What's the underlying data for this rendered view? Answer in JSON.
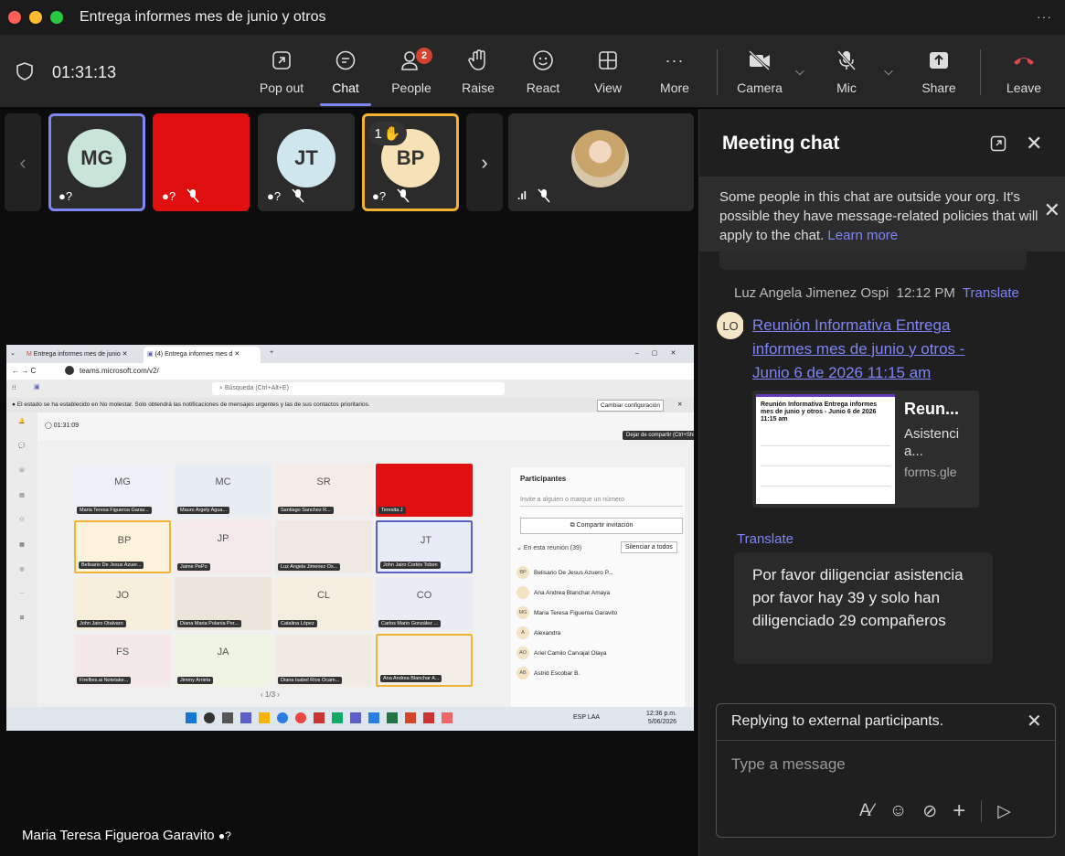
{
  "window": {
    "title": "Entrega informes mes de junio y otros",
    "more": "···"
  },
  "toolbar": {
    "timer": "01:31:13",
    "popout": "Pop out",
    "chat": "Chat",
    "people": "People",
    "people_badge": "2",
    "raise": "Raise",
    "react": "React",
    "view": "View",
    "more": "More",
    "camera": "Camera",
    "mic": "Mic",
    "share": "Share",
    "leave": "Leave"
  },
  "gallery": {
    "tiles": [
      {
        "initials": "MG",
        "color": "#c9e4d8"
      },
      {
        "initials": "",
        "color": "#e01010"
      },
      {
        "initials": "JT",
        "color": "#cfe6ec"
      },
      {
        "initials": "BP",
        "color": "#f7e2b7",
        "hand": "1"
      }
    ]
  },
  "shared": {
    "tab1": "Entrega informes mes de junio",
    "tab2": "(4) Entrega informes mes d",
    "url": "teams.microsoft.com/v2/",
    "search": "Búsqueda (Ctrl+Alt+E)",
    "dnd": "El estado se ha establecido en No molestar. Solo obtendrá las notificaciones de mensajes urgentes y las de sus contactos prioritarios.",
    "dnd_button": "Cambiar configuración",
    "timer": "01:31:09",
    "tooltip": "Dejar de compartir (Ctrl+Shift+E)",
    "participants_title": "Participantes",
    "invite_placeholder": "Invite a alguien o marque un número",
    "share_invite": "Compartir invitación",
    "in_meeting": "En esta reunión (39)",
    "mute_all": "Silenciar a todos",
    "pager": "1/3",
    "clock": "12:36 p.m.",
    "date": "5/06/2026",
    "lang": "ESP LAA",
    "grid": [
      {
        "ini": "MG",
        "name": "Maria Teresa Figueroa Garav..."
      },
      {
        "ini": "MC",
        "name": "Mauro Argely Agua..."
      },
      {
        "ini": "SR",
        "name": "Santiago Sanchez R..."
      },
      {
        "ini": "",
        "name": "Teresita J"
      },
      {
        "ini": "BP",
        "name": "Belisario De Jesus Azuer..."
      },
      {
        "ini": "JP",
        "name": "Jaime PePo"
      },
      {
        "ini": "",
        "name": "Luz Angela Jimenez Os..."
      },
      {
        "ini": "JT",
        "name": "John Jairo Cortés Tobon"
      },
      {
        "ini": "JO",
        "name": "John Jairo Otalvaro"
      },
      {
        "ini": "",
        "name": "Diana Maria Polania Per..."
      },
      {
        "ini": "CL",
        "name": "Catalina López"
      },
      {
        "ini": "CO",
        "name": "Carlos Mario González ..."
      },
      {
        "ini": "FS",
        "name": "Fireflies.ai Notetake..."
      },
      {
        "ini": "JA",
        "name": "Jimmy Arrieta"
      },
      {
        "ini": "",
        "name": "Diana Isabel Ríos Ocam..."
      },
      {
        "ini": "",
        "name": "Ana Andrea Blanchar A..."
      }
    ],
    "people": [
      {
        "ini": "BP",
        "name": "Belisario De Jesus Azuero P..."
      },
      {
        "ini": "",
        "name": "Ana Andrea Blanchar Amaya"
      },
      {
        "ini": "MG",
        "name": "Maria Teresa Figueroa Garavito"
      },
      {
        "ini": "A",
        "name": "Alexandra"
      },
      {
        "ini": "AO",
        "name": "Ariel Camilo Carvajal Olaya"
      },
      {
        "ini": "AB",
        "name": "Astrid Escobar B."
      }
    ]
  },
  "presenter": "Maria Teresa Figueroa Garavito",
  "chat": {
    "title": "Meeting chat",
    "notice": "Some people in this chat are outside your org. It's possible they have message-related policies that will apply to the chat.",
    "learn_more": "Learn more",
    "sender": "Luz Angela Jimenez Ospi",
    "time": "12:12 PM",
    "translate": "Translate",
    "avatar": "LO",
    "link_text": "Reunión Informativa Entrega informes mes de junio y otros - Junio 6 de 2026 11:15 am",
    "preview_title": "Reun...",
    "preview_desc": "Asistencia...",
    "preview_domain": "forms.gle",
    "preview_doc_title": "Reunión Informativa Entrega informes mes de junio y otros - Junio 6 de 2026 11:15 am",
    "translate2": "Translate",
    "message": "Por favor diligenciar asistencia por favor  hay 39 y solo han diligenciado 29  compañeros",
    "reply_banner": "Replying to external participants.",
    "compose_placeholder": "Type a message"
  }
}
